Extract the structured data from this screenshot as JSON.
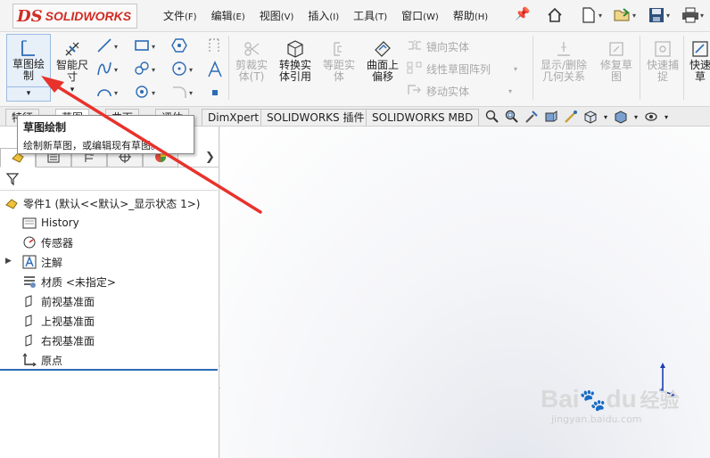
{
  "app": {
    "logo_mark": "DS",
    "logo_text": "SOLIDWORKS"
  },
  "menu": [
    {
      "label": "文件",
      "key": "(F)"
    },
    {
      "label": "编辑",
      "key": "(E)"
    },
    {
      "label": "视图",
      "key": "(V)"
    },
    {
      "label": "插入",
      "key": "(I)"
    },
    {
      "label": "工具",
      "key": "(T)"
    },
    {
      "label": "窗口",
      "key": "(W)"
    },
    {
      "label": "帮助",
      "key": "(H)"
    }
  ],
  "quick_access_icons": [
    "home-icon",
    "new-document-icon",
    "open-icon",
    "save-icon",
    "print-icon"
  ],
  "ribbon": {
    "sketch": {
      "line1": "草图绘",
      "line2": "制"
    },
    "smart_dim": {
      "line1": "智能尺",
      "line2": "寸"
    },
    "trim": {
      "line1": "剪裁实",
      "line2": "体(T)"
    },
    "convert": {
      "line1": "转换实",
      "line2": "体引用"
    },
    "offset": {
      "line1": "等距实",
      "line2": "体"
    },
    "surface_offset": {
      "line1": "曲面上",
      "line2": "偏移"
    },
    "mirror": "镜向实体",
    "linear_pattern": "线性草图阵列",
    "move": "移动实体",
    "show_relations": {
      "line1": "显示/删除",
      "line2": "几何关系"
    },
    "repair": {
      "line1": "修复草",
      "line2": "图"
    },
    "quick_snaps": {
      "line1": "快速捕",
      "line2": "捉"
    },
    "rapid": {
      "line1": "快速",
      "line2": "草"
    }
  },
  "tabs": [
    "特征",
    "草图",
    "曲面",
    "评估",
    "DimXpert",
    "SOLIDWORKS 插件",
    "SOLIDWORKS MBD"
  ],
  "tooltip": {
    "title": "草图绘制",
    "body": "绘制新草图，或编辑现有草图。"
  },
  "tree": {
    "root": "零件1 (默认<<默认>_显示状态 1>)",
    "items": [
      "History",
      "传感器",
      "注解",
      "材质 <未指定>",
      "前视基准面",
      "上视基准面",
      "右视基准面",
      "原点"
    ]
  },
  "watermark": {
    "brand": "Bai",
    "brand2": "du",
    "brand_cn": "经验",
    "url": "jingyan.baidu.com"
  },
  "colors": {
    "brand_red": "#d12b23",
    "arrow_red": "#e8322c",
    "accent_blue": "#2c6bb5"
  }
}
